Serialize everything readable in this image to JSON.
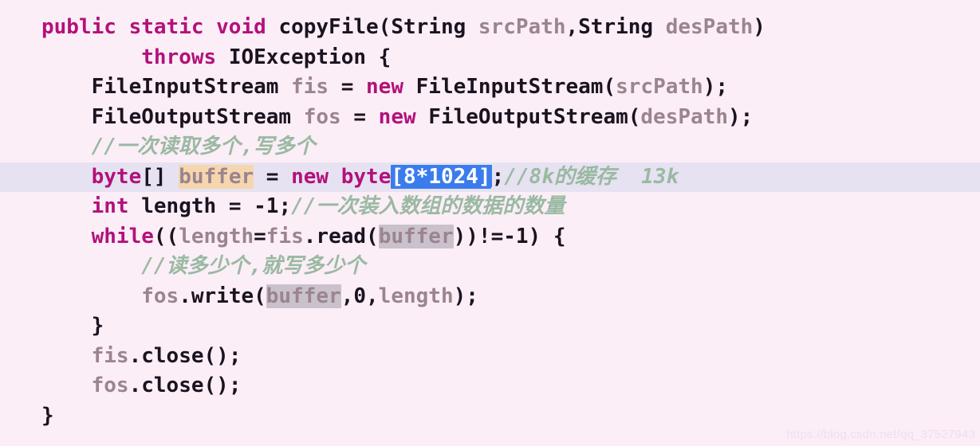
{
  "editor": {
    "language": "java",
    "background_color": "#fbeef7",
    "current_line_color": "#e6e2f2",
    "keyword_color": "#b3117a",
    "variable_color": "#9b8490",
    "comment_color": "#93b39b",
    "selection_color": "#3a7ced",
    "write_occurrence_color": "#f6d6ae",
    "read_occurrence_color": "#c9c2cc",
    "current_line_number": 6,
    "total_lines": 14
  },
  "code": {
    "line1": {
      "indent": "",
      "kw_public": "public",
      "sp1": " ",
      "kw_static": "static",
      "sp2": " ",
      "kw_void": "void",
      "sp3": " ",
      "method_name": "copyFile",
      "paren_open": "(",
      "type_string_1": "String",
      "sp4": " ",
      "param_src": "srcPath",
      "comma": ",",
      "type_string_2": "String",
      "sp5": " ",
      "param_des": "desPath",
      "paren_close": ")"
    },
    "line2": {
      "indent": "        ",
      "kw_throws": "throws",
      "sp1": " ",
      "exception_type": "IOException",
      "sp2": " ",
      "brace": "{"
    },
    "line3": {
      "indent": "    ",
      "type_name": "FileInputStream",
      "sp1": " ",
      "var_name": "fis",
      "eq": " = ",
      "kw_new": "new",
      "sp2": " ",
      "ctor": "FileInputStream",
      "paren_open": "(",
      "arg": "srcPath",
      "tail": ");"
    },
    "line4": {
      "indent": "    ",
      "type_name": "FileOutputStream",
      "sp1": " ",
      "var_name": "fos",
      "eq": " = ",
      "kw_new": "new",
      "sp2": " ",
      "ctor": "FileOutputStream",
      "paren_open": "(",
      "arg": "desPath",
      "tail": ");"
    },
    "line5": {
      "indent": "    ",
      "comment": "//一次读取多个,写多个"
    },
    "line6": {
      "indent": "    ",
      "kw_byte": "byte",
      "brackets": "[] ",
      "var_buffer": "buffer",
      "eq": " = ",
      "kw_new": "new",
      "sp": " ",
      "kw_byte2": "byte",
      "selection": "[8*1024]",
      "semi": ";",
      "comment": "//8k的缓存  13k"
    },
    "line7": {
      "indent": "    ",
      "kw_int": "int",
      "sp1": " ",
      "var_length": "length",
      "eq": " = ",
      "value": "-1",
      "semi": ";",
      "comment": "//一次装入数组的数据的数量"
    },
    "line8": {
      "indent": "    ",
      "kw_while": "while",
      "open": "((",
      "var_length": "length",
      "eq": "=",
      "var_fis": "fis",
      "dot_read": ".read(",
      "arg_buffer": "buffer",
      "close": "))!=-1) {"
    },
    "line9": {
      "indent": "        ",
      "comment": "//读多少个,就写多少个"
    },
    "line10": {
      "indent": "        ",
      "var_fos": "fos",
      "dot_write": ".write(",
      "arg_buffer": "buffer",
      "comma_zero": ",",
      "zero": "0",
      "comma2": ",",
      "arg_length": "length",
      "tail": ");"
    },
    "line11": {
      "indent": "    ",
      "brace": "}"
    },
    "line12": {
      "indent": "    ",
      "var_fis": "fis",
      "call": ".close();"
    },
    "line13": {
      "indent": "    ",
      "var_fos": "fos",
      "call": ".close();"
    },
    "line14": {
      "indent": "",
      "brace": "}"
    }
  },
  "watermark": {
    "text": "https://blog.csdn.net/qq_37527943"
  }
}
